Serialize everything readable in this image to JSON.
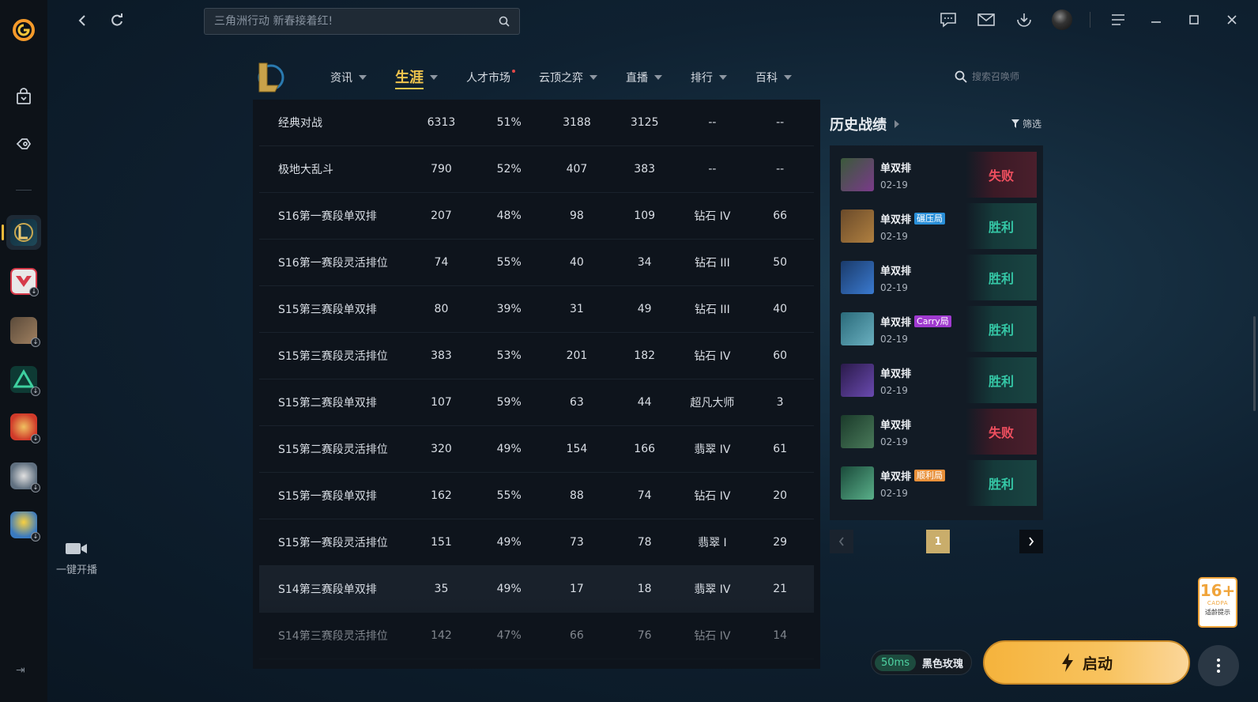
{
  "search": {
    "placeholder": "三角洲行动 新春接着红!"
  },
  "sidebar": {
    "stream_label": "一键开播"
  },
  "game_nav": {
    "items": [
      {
        "label": "资讯",
        "caret": true,
        "active": false,
        "dot": false
      },
      {
        "label": "生涯",
        "caret": true,
        "active": true,
        "dot": false
      },
      {
        "label": "人才市场",
        "caret": false,
        "active": false,
        "dot": true
      },
      {
        "label": "云顶之弈",
        "caret": true,
        "active": false,
        "dot": false
      },
      {
        "label": "直播",
        "caret": true,
        "active": false,
        "dot": false
      },
      {
        "label": "排行",
        "caret": true,
        "active": false,
        "dot": false
      },
      {
        "label": "百科",
        "caret": true,
        "active": false,
        "dot": false
      }
    ],
    "summoner_search_placeholder": "搜索召唤师"
  },
  "stats_table": {
    "rows": [
      [
        "经典对战",
        "6313",
        "51%",
        "3188",
        "3125",
        "--",
        "--"
      ],
      [
        "极地大乱斗",
        "790",
        "52%",
        "407",
        "383",
        "--",
        "--"
      ],
      [
        "S16第一赛段单双排",
        "207",
        "48%",
        "98",
        "109",
        "钻石 IV",
        "66"
      ],
      [
        "S16第一赛段灵活排位",
        "74",
        "55%",
        "40",
        "34",
        "钻石 III",
        "50"
      ],
      [
        "S15第三赛段单双排",
        "80",
        "39%",
        "31",
        "49",
        "钻石 III",
        "40"
      ],
      [
        "S15第三赛段灵活排位",
        "383",
        "53%",
        "201",
        "182",
        "钻石 IV",
        "60"
      ],
      [
        "S15第二赛段单双排",
        "107",
        "59%",
        "63",
        "44",
        "超凡大师",
        "3"
      ],
      [
        "S15第二赛段灵活排位",
        "320",
        "49%",
        "154",
        "166",
        "翡翠 IV",
        "61"
      ],
      [
        "S15第一赛段单双排",
        "162",
        "55%",
        "88",
        "74",
        "钻石 IV",
        "20"
      ],
      [
        "S15第一赛段灵活排位",
        "151",
        "49%",
        "73",
        "78",
        "翡翠 I",
        "29"
      ],
      [
        "S14第三赛段单双排",
        "35",
        "49%",
        "17",
        "18",
        "翡翠 IV",
        "21"
      ],
      [
        "S14第三赛段灵活排位",
        "142",
        "47%",
        "66",
        "76",
        "钻石 IV",
        "14"
      ]
    ]
  },
  "history": {
    "title": "历史战绩",
    "filter_label": "筛选",
    "matches": [
      {
        "mode": "单双排",
        "tag": "",
        "tag_color": "",
        "date": "02-19",
        "result": "失败",
        "win": false,
        "champ_colors": [
          "#3a5a3a",
          "#7a3a8a"
        ]
      },
      {
        "mode": "单双排",
        "tag": "碾压局",
        "tag_color": "#2a8fd8",
        "date": "02-19",
        "result": "胜利",
        "win": true,
        "champ_colors": [
          "#6a4a2a",
          "#b08040"
        ]
      },
      {
        "mode": "单双排",
        "tag": "",
        "tag_color": "",
        "date": "02-19",
        "result": "胜利",
        "win": true,
        "champ_colors": [
          "#1a3a6a",
          "#3a7ad0"
        ]
      },
      {
        "mode": "单双排",
        "tag": "Carry局",
        "tag_color": "#a03ad0",
        "date": "02-19",
        "result": "胜利",
        "win": true,
        "champ_colors": [
          "#2a6a7a",
          "#6ab0c0"
        ]
      },
      {
        "mode": "单双排",
        "tag": "",
        "tag_color": "",
        "date": "02-19",
        "result": "胜利",
        "win": true,
        "champ_colors": [
          "#2a1a4a",
          "#6a4ab0"
        ]
      },
      {
        "mode": "单双排",
        "tag": "",
        "tag_color": "",
        "date": "02-19",
        "result": "失败",
        "win": false,
        "champ_colors": [
          "#1a3a2a",
          "#4a7a5a"
        ]
      },
      {
        "mode": "单双排",
        "tag": "顺利局",
        "tag_color": "#e8903a",
        "date": "02-19",
        "result": "胜利",
        "win": true,
        "champ_colors": [
          "#1a4a3a",
          "#5ab08a"
        ]
      }
    ],
    "page": "1"
  },
  "footer": {
    "ping": "50ms",
    "server": "黑色玫瑰",
    "launch_label": "启动",
    "age_rating": "16+",
    "age_org": "CADPA",
    "age_tip": "适龄提示"
  },
  "colors": {
    "accent_gold": "#f1c54d",
    "win": "#35c7a6",
    "loss": "#ef4f5f",
    "launch": "#f5b33c"
  }
}
